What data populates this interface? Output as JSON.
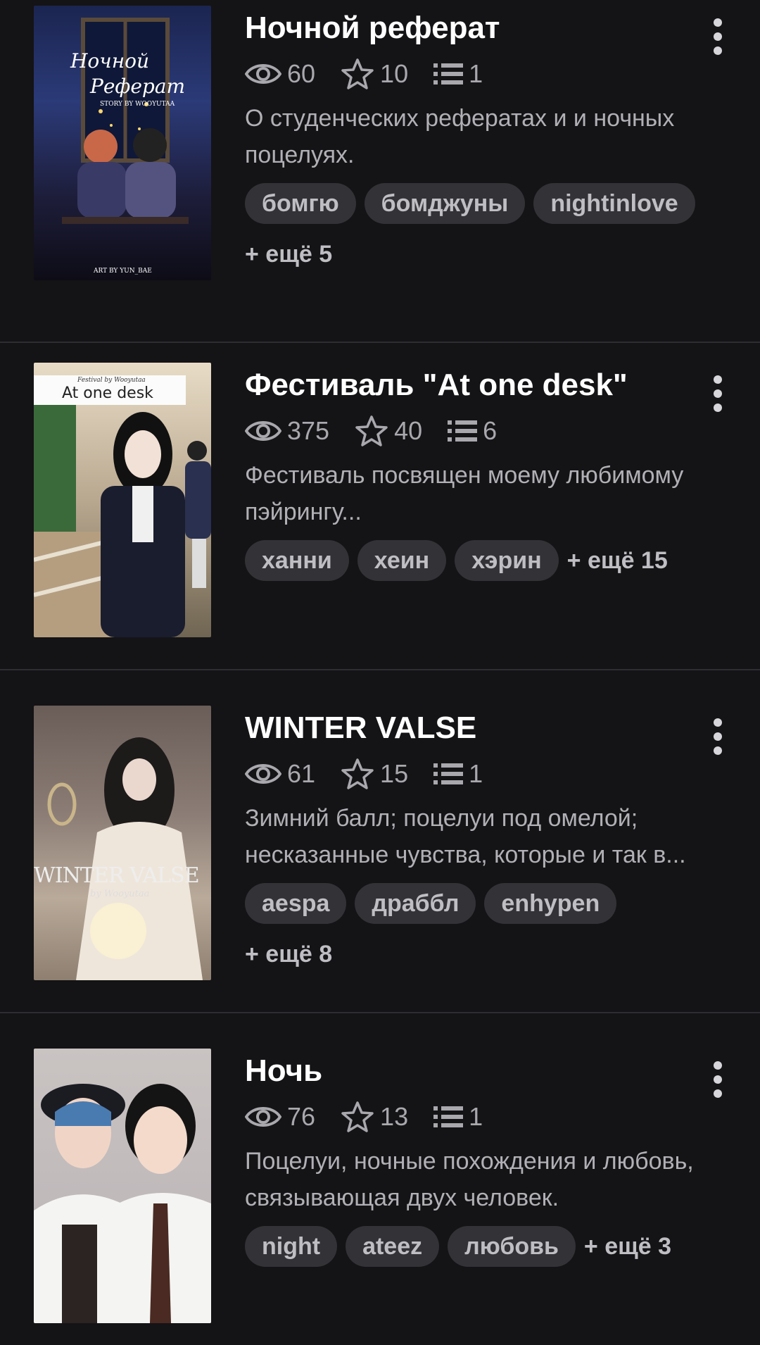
{
  "stories": [
    {
      "title": "Ночной реферат",
      "views": "60",
      "stars": "10",
      "chapters": "1",
      "description": "О студенческих рефератах и и ночных поцелуях.",
      "tags": [
        "бомгю",
        "бомджуны",
        "nightinlove"
      ],
      "more": "+ ещё 5",
      "cover": {
        "line1": "Ночной",
        "line2": "Реферат",
        "line3": "STORY BY WOOYUTAA",
        "line4": "ART BY YUN_BAE"
      }
    },
    {
      "title": "Фестиваль \"At one desk\"",
      "views": "375",
      "stars": "40",
      "chapters": "6",
      "description": "Фестиваль посвящен моему любимому пэйрингу...",
      "tags": [
        "ханни",
        "хеин",
        "хэрин"
      ],
      "more": "+ ещё 15",
      "cover": {
        "line1": "Festival by Wooyutaa",
        "line2": "At one desk"
      }
    },
    {
      "title": "WINTER VALSE",
      "views": "61",
      "stars": "15",
      "chapters": "1",
      "description": "Зимний балл; поцелуи под омелой; несказанные чувства, которые и так в...",
      "tags": [
        "aespa",
        "драббл",
        "enhypen"
      ],
      "more": "+ ещё 8",
      "cover": {
        "line1": "WINTER VALSE",
        "line2": "by Wooyutaa"
      }
    },
    {
      "title": "Ночь",
      "views": "76",
      "stars": "13",
      "chapters": "1",
      "description": "Поцелуи, ночные похождения и любовь, связывающая двух человек.",
      "tags": [
        "night",
        "ateez",
        "любовь"
      ],
      "more": "+ ещё 3",
      "cover": {}
    }
  ]
}
